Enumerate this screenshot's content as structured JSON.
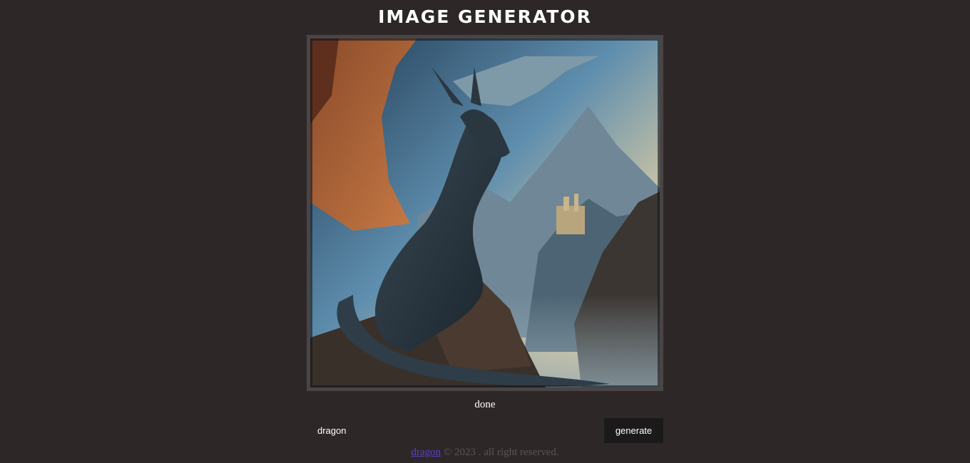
{
  "header": {
    "title": "IMAGE GENERATOR"
  },
  "image": {
    "alt": "dragon"
  },
  "status": {
    "text": "done"
  },
  "prompt": {
    "value": "dragon",
    "placeholder": ""
  },
  "generate_button": {
    "label": "generate"
  },
  "footer": {
    "link_text": "dragon",
    "copyright": "© 2023 . all right reserved."
  },
  "colors": {
    "background": "#2d2827",
    "frame_border": "#4a4545",
    "button_bg": "#1b1a1a",
    "footer_text": "#5a5554",
    "link": "#5b3fc2"
  }
}
